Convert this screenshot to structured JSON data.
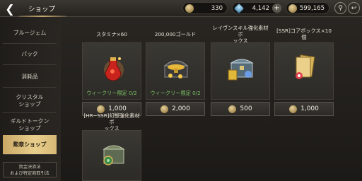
{
  "header": {
    "title": "ショップ",
    "currencies": [
      {
        "icon": "medal-coin-icon",
        "value": "330"
      },
      {
        "icon": "gem-icon",
        "value": "4,142"
      },
      {
        "icon": "gold-coin-icon",
        "value": "599,165"
      }
    ]
  },
  "sidebar": {
    "items": [
      {
        "label": "ブルージェム"
      },
      {
        "label": "パック"
      },
      {
        "label": "消耗品"
      },
      {
        "label": "クリスタル\nショップ"
      },
      {
        "label": "ギルドトークン\nショップ"
      },
      {
        "label": "勲章ショップ",
        "active": true
      }
    ],
    "footer": "資金決済法\nおよび特定商取引法"
  },
  "items": [
    {
      "name": "スタミナ×60",
      "limit": "ウィークリー限定 0/2",
      "price": "1,000",
      "art": "stamina-potion-icon"
    },
    {
      "name": "200,000ゴールド",
      "limit": "ウィークリー限定 0/2",
      "price": "2,000",
      "art": "gold-chest-icon"
    },
    {
      "name": "レイヴンスキル強化素材ボ\nックス",
      "limit": "",
      "price": "500",
      "art": "skill-material-box-icon"
    },
    {
      "name": "[SSR]コアボックス×10個",
      "limit": "",
      "price": "1,000",
      "art": "core-box-icon"
    },
    {
      "name": "[HR~SSR]幻獣強化素材ボ\nックス",
      "limit": "",
      "price": "",
      "art": "beast-material-box-icon"
    }
  ],
  "colors": {
    "accent_gold": "#d6b774",
    "limit_green": "#7cc466"
  }
}
